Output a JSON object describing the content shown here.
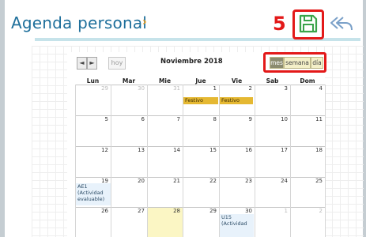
{
  "header": {
    "title": "Agenda personal",
    "chevron": "›",
    "step_number": "5",
    "save_icon": "save-icon",
    "back_icon": "reply-all-icon"
  },
  "toolbar": {
    "prev": "◄",
    "next": "►",
    "today": "hoy",
    "month_title": "Noviembre 2018",
    "views": [
      "mes",
      "semana",
      "día"
    ],
    "active_view": "mes"
  },
  "weekdays": [
    "Lun",
    "Mar",
    "Mie",
    "Jue",
    "Vie",
    "Sab",
    "Dom"
  ],
  "weeks": [
    {
      "days": [
        "29",
        "30",
        "31",
        "1",
        "2",
        "3",
        "4"
      ],
      "other": [
        true,
        true,
        true,
        false,
        false,
        false,
        false
      ]
    },
    {
      "days": [
        "5",
        "6",
        "7",
        "8",
        "9",
        "10",
        "11"
      ],
      "other": [
        false,
        false,
        false,
        false,
        false,
        false,
        false
      ]
    },
    {
      "days": [
        "12",
        "13",
        "14",
        "15",
        "16",
        "17",
        "18"
      ],
      "other": [
        false,
        false,
        false,
        false,
        false,
        false,
        false
      ]
    },
    {
      "days": [
        "19",
        "20",
        "21",
        "22",
        "23",
        "24",
        "25"
      ],
      "other": [
        false,
        false,
        false,
        false,
        false,
        false,
        false
      ]
    },
    {
      "days": [
        "26",
        "27",
        "28",
        "29",
        "30",
        "1",
        "2"
      ],
      "other": [
        false,
        false,
        false,
        false,
        false,
        true,
        true
      ]
    }
  ],
  "events": {
    "festivo_thu": "Festivo",
    "festivo_fri": "Festivo",
    "ae1": "AE1 (Actividad evaluable)",
    "u15": "U15 (Actividad"
  },
  "colors": {
    "title": "#1e6f9b",
    "chevron": "#f4a11b",
    "highlight": "#e31919",
    "festivo": "#e5b832",
    "today": "#fbf6c4"
  }
}
